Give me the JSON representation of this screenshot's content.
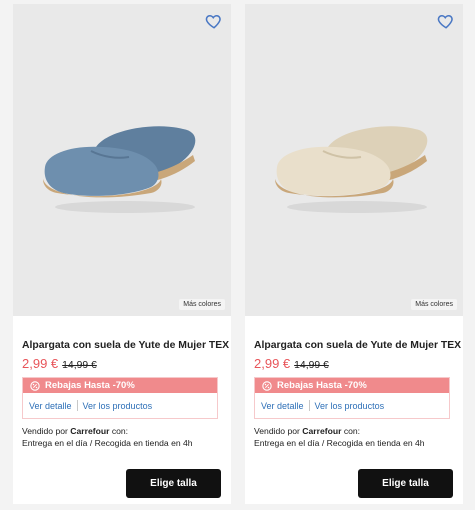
{
  "products": [
    {
      "title": "Alpargata con suela de Yute de Mujer TEX",
      "price": "2,99 €",
      "old_price": "14,99 €",
      "more_colors": "Más colores",
      "promo": "Rebajas Hasta -70%",
      "link_detail": "Ver detalle",
      "link_products": "Ver los productos",
      "sold_prefix": "Vendido por",
      "seller": "Carrefour",
      "sold_suffix": "con:",
      "delivery": "Entrega en el día /  Recogida en tienda en 4h",
      "button": "Elige talla",
      "shoe_color": "#6e8fae"
    },
    {
      "title": "Alpargata con suela de Yute de Mujer TEX",
      "price": "2,99 €",
      "old_price": "14,99 €",
      "more_colors": "Más colores",
      "promo": "Rebajas Hasta -70%",
      "link_detail": "Ver detalle",
      "link_products": "Ver los productos",
      "sold_prefix": "Vendido por",
      "seller": "Carrefour",
      "sold_suffix": "con:",
      "delivery": "Entrega en el día /  Recogida en tienda en 4h",
      "button": "Elige talla",
      "shoe_color": "#e9dfcb"
    }
  ],
  "colors": {
    "accent_price": "#e8555a",
    "promo_bar": "#f08a8c",
    "link": "#2d6fb7",
    "heart": "#4a78c4",
    "button": "#111111"
  },
  "icons": [
    "heart-icon",
    "discount-icon"
  ]
}
